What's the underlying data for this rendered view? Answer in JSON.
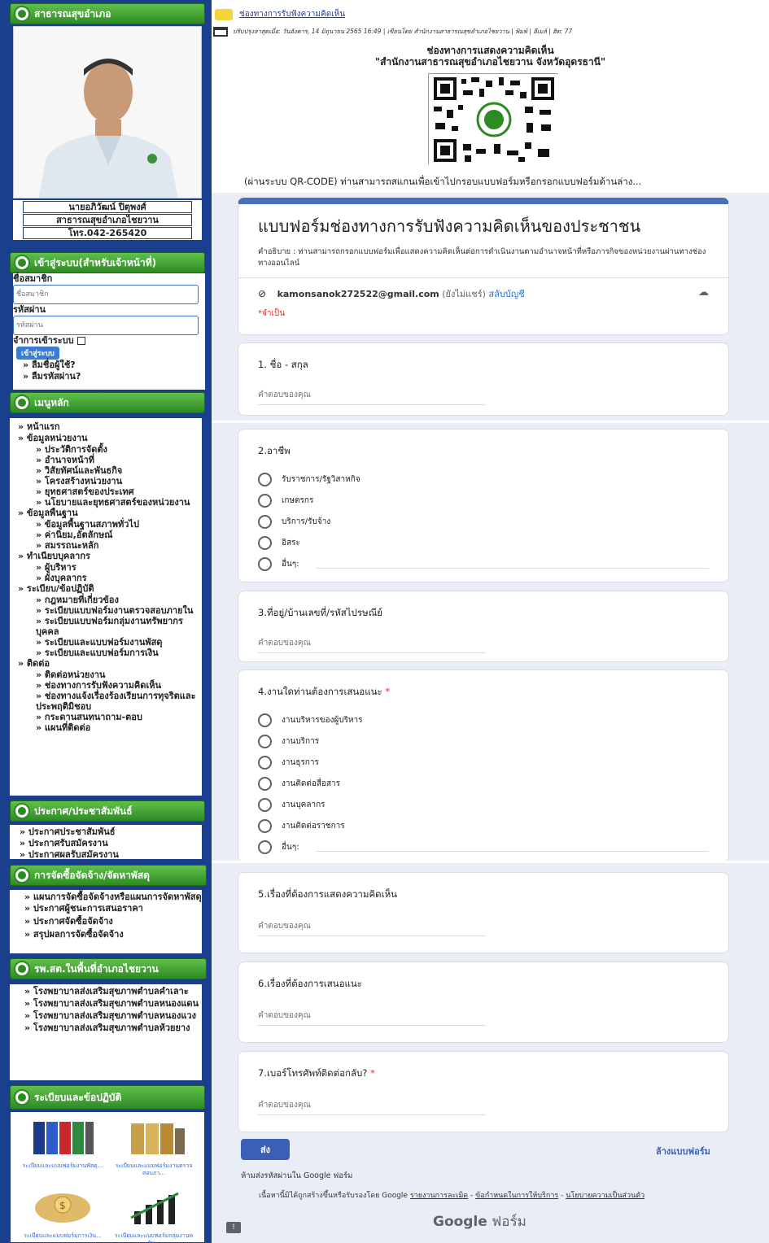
{
  "sidebar": {
    "header1": "สาธารณสุขอำเภอ",
    "person": {
      "name": "นายอภิวัฒน์ ปิตุพงศ์",
      "position": "สาธารณสุขอำเภอไชยวาน",
      "phone": "โทร.042-265420"
    },
    "login": {
      "header": "เข้าสู่ระบบ(สำหรับเจ้าหน้าที่)",
      "username_label": "ชื่อสมาชิก",
      "username_placeholder": "ชื่อสมาชิก",
      "password_label": "รหัสผ่าน",
      "password_placeholder": "รหัสผ่าน",
      "remember_label": "จำการเข้าระบบ",
      "login_button": "เข้าสู่ระบบ",
      "forgot_user": "» ลืมชื่อผู้ใช้?",
      "forgot_pass": "» ลืมรหัสผ่าน?"
    },
    "main_menu_header": "เมนูหลัก",
    "main_menu": [
      {
        "t": "» หน้าแรก",
        "lvl": 0
      },
      {
        "t": "» ข้อมูลหน่วยงาน",
        "lvl": 0
      },
      {
        "t": "» ประวัติการจัดตั้ง",
        "lvl": 1
      },
      {
        "t": "» อำนาจหน้าที่",
        "lvl": 1
      },
      {
        "t": "» วิสัยทัศน์และพันธกิจ",
        "lvl": 1
      },
      {
        "t": "» โครงสร้างหน่วยงาน",
        "lvl": 1
      },
      {
        "t": "» ยุทธศาสตร์ของประเทศ",
        "lvl": 1
      },
      {
        "t": "» นโยบายและยุทธศาสตร์ของหน่วยงาน",
        "lvl": 1
      },
      {
        "t": "» ข้อมูลพื้นฐาน",
        "lvl": 0
      },
      {
        "t": "» ข้อมูลพื้นฐานสภาพทั่วไป",
        "lvl": 1
      },
      {
        "t": "» ค่านิยม,อัตลักษณ์",
        "lvl": 1
      },
      {
        "t": "» สมรรถนะหลัก",
        "lvl": 1
      },
      {
        "t": "» ทำเนียบบุคลากร",
        "lvl": 0
      },
      {
        "t": "» ผู้บริหาร",
        "lvl": 1
      },
      {
        "t": "» ผังบุคลากร",
        "lvl": 1
      },
      {
        "t": "» ระเบียบ/ข้อปฏิบัติ",
        "lvl": 0
      },
      {
        "t": "» กฎหมายที่เกี่ยวข้อง",
        "lvl": 1
      },
      {
        "t": "» ระเบียบแบบฟอร์มงานตรวจสอบภายใน",
        "lvl": 1
      },
      {
        "t": "» ระเบียบแบบฟอร์มกลุ่มงานทรัพยากรบุคคล",
        "lvl": 1
      },
      {
        "t": "» ระเบียบและแบบฟอร์มงานพัสดุ",
        "lvl": 1
      },
      {
        "t": "» ระเบียบและแบบฟอร์มการเงิน",
        "lvl": 1
      },
      {
        "t": "» ติดต่อ",
        "lvl": 0
      },
      {
        "t": "» ติดต่อหน่วยงาน",
        "lvl": 1
      },
      {
        "t": "» ช่องทางการรับฟังความคิดเห็น",
        "lvl": 1
      },
      {
        "t": "» ช่องทางแจ้งเรื่องร้องเรียนการทุจริตและประพฤติมิชอบ",
        "lvl": 1
      },
      {
        "t": "» กระดานสนทนาถาม-ตอบ",
        "lvl": 1
      },
      {
        "t": "» แผนที่ติดต่อ",
        "lvl": 1
      }
    ],
    "pr_header": "ประกาศ/ประชาสัมพันธ์",
    "pr_items": [
      "» ประกาศประชาสัมพันธ์",
      "» ประกาศรับสมัครงาน",
      "» ประกาศผลรับสมัครงาน"
    ],
    "proc_header": "การจัดซื้อจัดจ้าง/จัดหาพัสดุ",
    "proc_items": [
      "» แผนการจัดซื้อจัดจ้างหรือแผนการจัดหาพัสดุ",
      "» ประกาศผู้ชนะการเสนอราคา",
      "» ประกาศจัดซื้อจัดจ้าง",
      "» สรุปผลการจัดซื้อจัดจ้าง"
    ],
    "hosp_header": "รพ.สต.ในพื้นที่อำเภอไชยวาน",
    "hosp_items": [
      "» โรงพยาบาลส่งเสริมสุขภาพตำบลคำเลาะ",
      "» โรงพยาบาลส่งเสริมสุขภาพตำบลหนองแดน",
      "» โรงพยาบาลส่งเสริมสุขภาพตำบลหนองแวง",
      "» โรงพยาบาลส่งเสริมสุขภาพตำบลห้วยยาง"
    ],
    "reg_header": "ระเบียบและข้อปฏิบัติ",
    "reg_items": [
      "ระเบียบและแบบฟอร์มงานพัสดุ...",
      "ระเบียบและแบบฟอร์มงานตรวจสอบภา...",
      "ระเบียบและแบบฟอร์มการเงิน...",
      "ระเบียบและแบบฟอร์มกลุ่มงานทรัพ..."
    ]
  },
  "article": {
    "breadcrumb": "ช่องทางการรับฟังความคิดเห็น",
    "meta": "ปรับปรุงล่าสุดเมื่อ: วันอังคาร, 14 มิถุนายน 2565 16:49  |  เขียนโดย สำนักงานสาธารณสุขอำเภอไชยวาน | พิมพ์ | อีเมล์ | ฮิต: 77",
    "title_line1": "ช่องทางการแสดงความคิดเห็น",
    "title_line2": "\"สำนักงานสาธารณสุขอำเภอไชยวาน  จังหวัดอุดรธานี\"",
    "qr_note": "(ผ่านระบบ QR-CODE) ท่านสามารถสแกนเพื่อเข้าไปกรอบแบบฟอร์มหรือกรอกแบบฟอร์มด้านล่าง..."
  },
  "form": {
    "title": "แบบฟอร์มช่องทางการรับฟังความคิดเห็นของประชาชน",
    "description": "คำอธิบาย : ท่านสามารถกรอกแบบฟอร์มเพื่อแสดงความคิดเห็นต่อการดำเนินงานตามอำนาจหน้าที่หรือภารกิจของหน่วยงานผ่านทางช่องทางออนไลน์",
    "email": "kamonsanok272522@gmail.com",
    "not_shared": "(ยังไม่แชร์)",
    "switch_account": "สลับบัญชี",
    "required_note": "*จำเป็น",
    "answer_placeholder": "คำตอบของคุณ",
    "q1": "1. ชื่อ - สกุล",
    "q2": "2.อาชีพ",
    "q2_options": [
      "รับราชการ/รัฐวิสาหกิจ",
      "เกษตรกร",
      "บริการ/รับจ้าง",
      "อิสระ",
      "อื่นๆ:"
    ],
    "q3": "3.ที่อยู่/บ้านเลขที่/รหัสไปรษณีย์",
    "q4": "4.งานใดท่านต้องการเสนอแนะ",
    "q4_options": [
      "งานบริหารของผู้บริหาร",
      "งานบริการ",
      "งานธุรการ",
      "งานติดต่อสื่อสาร",
      "งานบุคลากร",
      "งานติดต่อราชการ",
      "อื่นๆ:"
    ],
    "q5": "5.เรื่องที่ต้องการแสดงความคิดเห็น",
    "q6": "6.เรื่องที่ต้องการเสนอแนะ",
    "q7": "7.เบอร์โทรศัพท์ติดต่อกลับ?",
    "required_star": "*",
    "submit": "ส่ง",
    "clear": "ล้างแบบฟอร์ม",
    "no_password": "ห้ามส่งรหัสผ่านใน Google ฟอร์ม",
    "disclaimer": "เนื้อหานี้มิได้ถูกสร้างขึ้นหรือรับรองโดย Google",
    "link1": "รายงานการละเมิด",
    "link2": "ข้อกำหนดในการให้บริการ",
    "link3": "นโยบายความเป็นส่วนตัว",
    "brand1": "Google",
    "brand2": " ฟอร์ม"
  }
}
